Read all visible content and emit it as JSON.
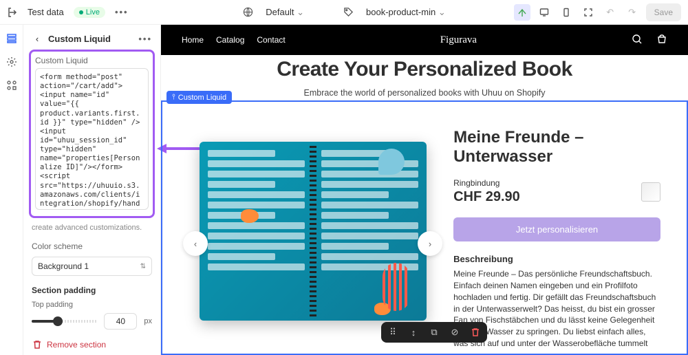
{
  "topbar": {
    "left_label": "Test data",
    "badge": "Live",
    "center_default": "Default",
    "center_tag": "book-product-min",
    "save": "Save"
  },
  "sidebar": {
    "title": "Custom Liquid",
    "field_label": "Custom Liquid",
    "code": "<form method=\"post\" action=\"/cart/add\"><input name=\"id\" value=\"{{ product.variants.first.id }}\" type=\"hidden\" /><input id=\"uhuu_session_id\" type=\"hidden\" name=\"properties[Personalize ID]\"/></form>\n<script src=\"https://uhuuio.s3.amazonaws.com/clients/integration/shopify/handshake.js\"></scr ipt>\n<embed src=\"https://uhuu-shop.vercel.app/de/shopify/{{ product.variants.first.barcode}",
    "helper": "create advanced customizations.",
    "color_scheme_label": "Color scheme",
    "color_scheme_value": "Background 1",
    "section_padding": "Section padding",
    "top_padding": "Top padding",
    "top_padding_value": "40",
    "px": "px",
    "remove": "Remove section"
  },
  "preview": {
    "nav": [
      "Home",
      "Catalog",
      "Contact"
    ],
    "logo": "Figurava",
    "hero_title": "Create Your Personalized Book",
    "hero_sub": "Embrace the world of personalized books with Uhuu on Shopify",
    "chip": "Custom Liquid",
    "product": {
      "title": "Meine Freunde – Unterwasser",
      "binding": "Ringbindung",
      "price": "CHF 29.90",
      "cta": "Jetzt personalisieren",
      "desc_heading": "Beschreibung",
      "desc": "Meine Freunde – Das persönliche Freundschaftsbuch. Einfach deinen Namen eingeben und ein Profilfoto hochladen und fertig. Dir gefällt das Freundschaftsbuch in der Unterwasserwelt? Das heisst, du bist ein grosser Fan von Fischstäbchen und du lässt keine Gelegenheit aus, in's Wasser zu springen. Du liebst einfach alles, was sich auf und unter der Wasserobefläche tummelt"
    }
  }
}
